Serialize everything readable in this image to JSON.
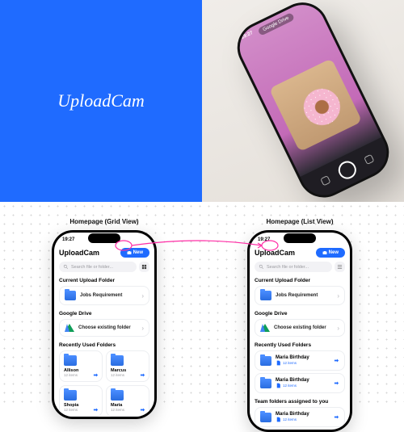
{
  "brand": {
    "name": "UploadCam"
  },
  "hero": {
    "time": "19:27",
    "pill": "Google Drive"
  },
  "columns": [
    {
      "title": "Homepage (Grid View)"
    },
    {
      "title": "Homepage (List View)"
    }
  ],
  "app": {
    "time": "19:27",
    "title": "UploadCam",
    "new_label": "New",
    "search_placeholder": "Search file or folder..."
  },
  "sections": {
    "current": {
      "title": "Current Upload Folder",
      "item": "Jobs Requirement"
    },
    "drive": {
      "title": "Google Drive",
      "item": "Choose existing folder"
    },
    "recent": {
      "title": "Recently Used Folders"
    },
    "team": {
      "title": "Team folders assigned to you"
    }
  },
  "grid_folders": [
    {
      "name": "Allison",
      "meta": "12 items"
    },
    {
      "name": "Marcus",
      "meta": "12 items"
    },
    {
      "name": "Shopia",
      "meta": "12 items"
    },
    {
      "name": "Maria",
      "meta": "12 items"
    }
  ],
  "list_folders": [
    {
      "name": "Maria Birthday",
      "meta": "12 items"
    },
    {
      "name": "Maria Birthday",
      "meta": "12 items"
    },
    {
      "name": "Maria Birthday",
      "meta": "12 items"
    }
  ]
}
